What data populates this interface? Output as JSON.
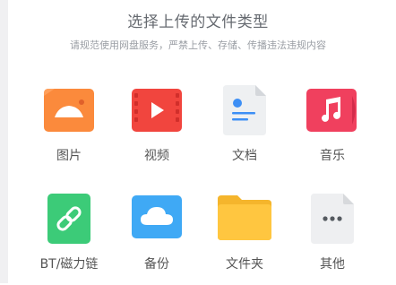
{
  "header": {
    "title": "选择上传的文件类型",
    "subtitle": "请规范使用网盘服务，严禁上传、存储、传播违法违规内容"
  },
  "types": [
    {
      "label": "图片",
      "icon": "image-icon"
    },
    {
      "label": "视频",
      "icon": "video-icon"
    },
    {
      "label": "文档",
      "icon": "document-icon"
    },
    {
      "label": "音乐",
      "icon": "music-icon"
    },
    {
      "label": "BT/磁力链",
      "icon": "link-icon"
    },
    {
      "label": "备份",
      "icon": "cloud-backup-icon"
    },
    {
      "label": "文件夹",
      "icon": "folder-icon"
    },
    {
      "label": "其他",
      "icon": "more-icon"
    }
  ],
  "colors": {
    "image": "#fb8a3c",
    "video": "#f1453e",
    "document": "#eef0f2",
    "music": "#f0405e",
    "link": "#3ccb78",
    "backup": "#3fa9f5",
    "folder": "#ffc640",
    "other": "#eeeff1"
  }
}
